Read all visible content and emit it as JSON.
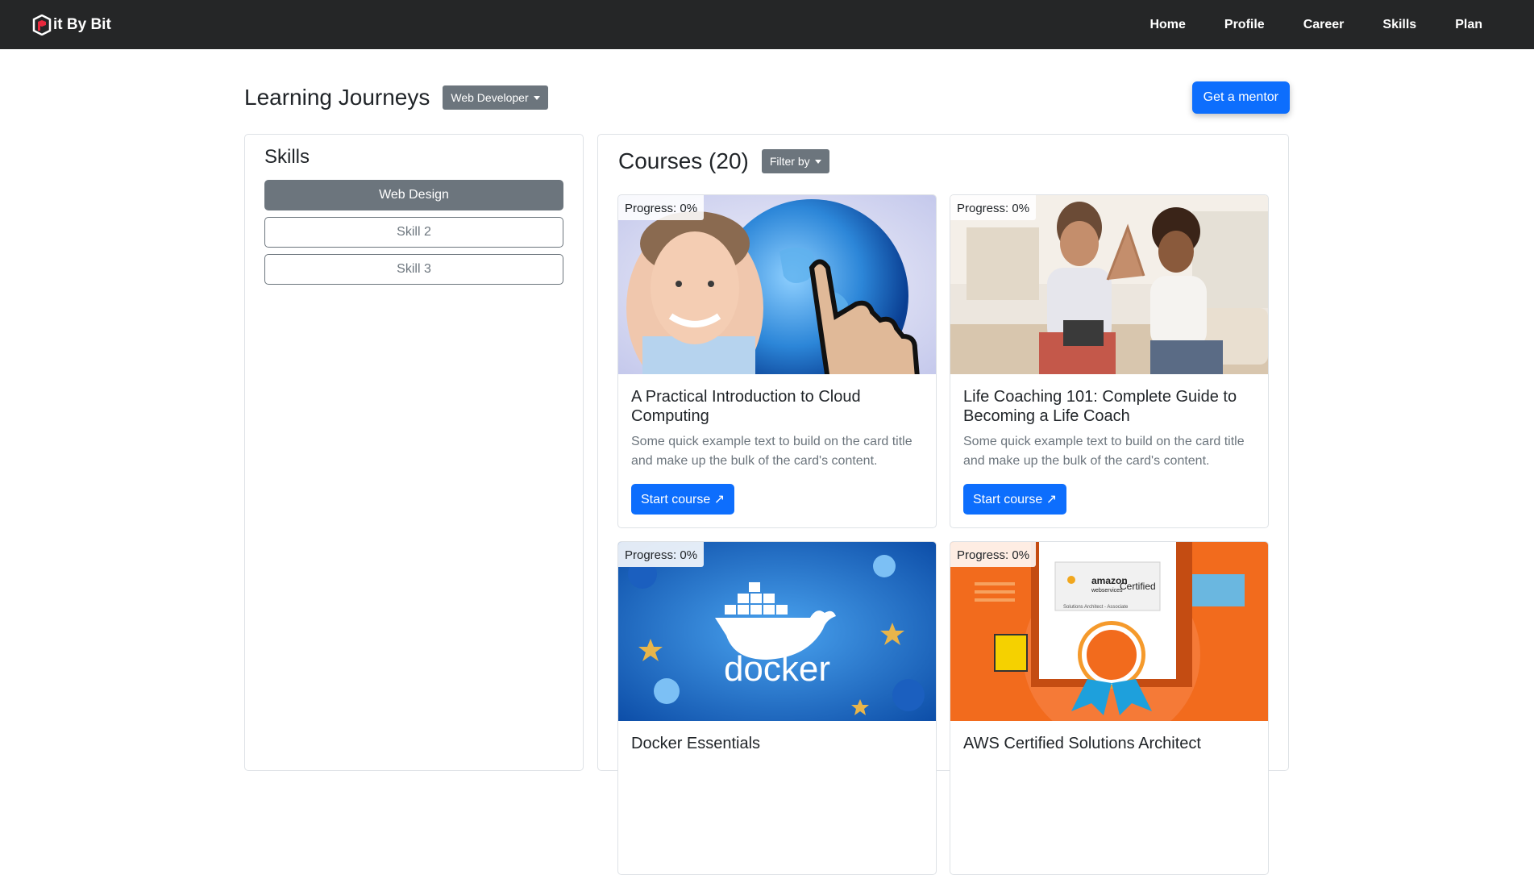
{
  "navbar": {
    "brand": "it By Bit",
    "links": [
      "Home",
      "Profile",
      "Career",
      "Skills",
      "Plan"
    ]
  },
  "header": {
    "title": "Learning Journeys",
    "journey_dropdown": "Web Developer",
    "mentor_button": "Get a mentor"
  },
  "skills": {
    "title": "Skills",
    "items": [
      "Web Design",
      "Skill 2",
      "Skill 3"
    ],
    "active_index": 0
  },
  "courses": {
    "title": "Courses (20)",
    "filter_label": "Filter by",
    "items": [
      {
        "progress": "Progress: 0%",
        "progress_value": 0,
        "title": "A Practical Introduction to Cloud Computing",
        "text": "Some quick example text to build on the card title and make up the bulk of the card's content.",
        "button": "Start course ↗",
        "image": "cloud-computing-image"
      },
      {
        "progress": "Progress: 0%",
        "progress_value": 0,
        "title": "Life Coaching 101: Complete Guide to Becoming a Life Coach",
        "text": "Some quick example text to build on the card title and make up the bulk of the card's content.",
        "button": "Start course ↗",
        "image": "life-coaching-image"
      },
      {
        "progress": "Progress: 0%",
        "progress_value": 0,
        "title": "Docker Essentials",
        "image": "docker-image",
        "logo_text": "docker"
      },
      {
        "progress": "Progress: 0%",
        "progress_value": 0,
        "title": "AWS Certified Solutions Architect",
        "image": "aws-certificate-image",
        "logo_text": "amazon",
        "logo_subtext": "webservices",
        "cert_text": "Certified",
        "cert_subtext": "Solutions Architect - Associate"
      }
    ]
  },
  "colors": {
    "navbar": "#252627",
    "primary": "#0d6efd",
    "secondary": "#6c757d",
    "border": "#dee2e6"
  }
}
